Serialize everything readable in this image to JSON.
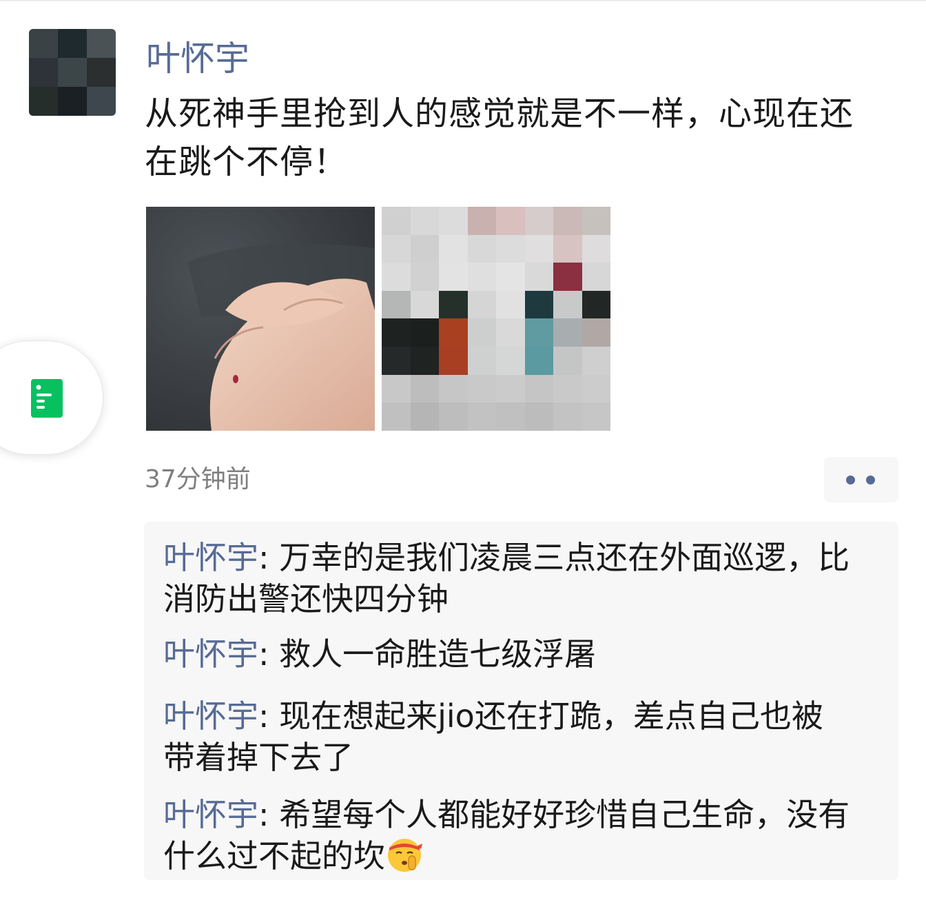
{
  "post": {
    "author": "叶怀宇",
    "text": "从死神手里抢到人的感觉就是不一样，心现在还在跳个不停！",
    "time": "37分钟前"
  },
  "icons": {
    "more": "more-dots-icon",
    "floating_tab": "document-list-icon",
    "emoji": "shushing-face-emoji-icon"
  },
  "comments": [
    {
      "name": "叶怀宇",
      "sep": ": ",
      "text": "万幸的是我们凌晨三点还在外面巡逻，比消防出警还快四分钟"
    },
    {
      "name": "叶怀宇",
      "sep": ": ",
      "text": "救人一命胜造七级浮屠"
    },
    {
      "name": "叶怀宇",
      "sep": ": ",
      "text": "现在想起来jio还在打跪，差点自己也被带着掉下去了"
    },
    {
      "name": "叶怀宇",
      "sep": ": ",
      "text": "希望每个人都能好好珍惜自己生命，没有什么过不起的坎"
    }
  ],
  "colors": {
    "link_blue": "#576b95",
    "text": "#1a1a1a",
    "time_gray": "#7f7f7f",
    "panel_bg": "#f7f7f7",
    "icon_green": "#07c160"
  }
}
